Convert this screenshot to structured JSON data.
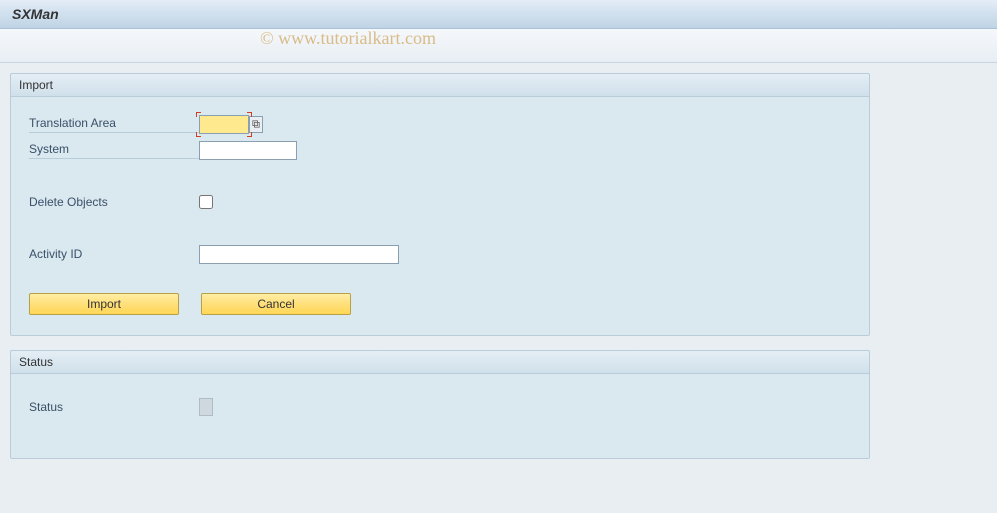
{
  "titleBar": {
    "title": "SXMan"
  },
  "watermark": {
    "text": "© www.tutorialkart.com"
  },
  "importPanel": {
    "header": "Import",
    "fields": {
      "translationArea": {
        "label": "Translation Area",
        "value": ""
      },
      "system": {
        "label": "System",
        "value": ""
      },
      "deleteObjects": {
        "label": "Delete Objects",
        "checked": false
      },
      "activityId": {
        "label": "Activity ID",
        "value": ""
      }
    },
    "buttons": {
      "import": "Import",
      "cancel": "Cancel"
    }
  },
  "statusPanel": {
    "header": "Status",
    "fields": {
      "status": {
        "label": "Status",
        "value": ""
      }
    }
  }
}
